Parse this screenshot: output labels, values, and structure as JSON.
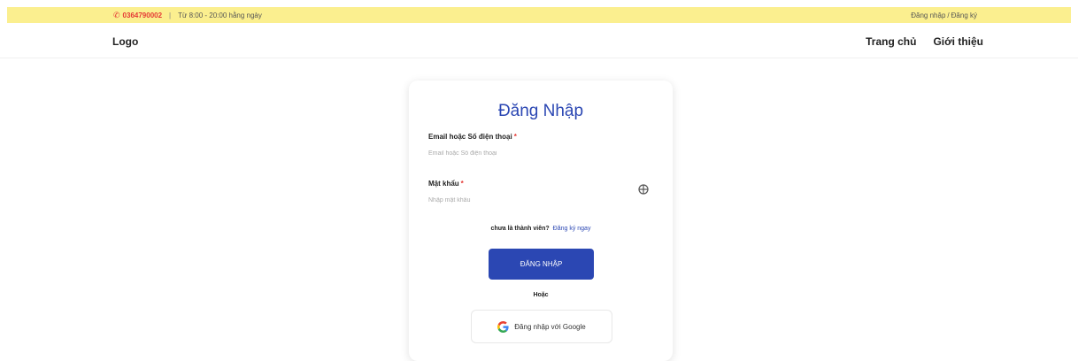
{
  "topbar": {
    "phone": "0364790002",
    "hours": "Từ 8:00 - 20:00 hằng ngày",
    "login_link": "Đăng nhập",
    "register_link": "Đăng ký",
    "separator": "/",
    "background_color": "#fbef8f"
  },
  "header": {
    "logo": "Logo",
    "nav": [
      "Trang chủ",
      "Giới thiệu"
    ]
  },
  "login_form": {
    "title": "Đăng Nhập",
    "email_label": "Email hoặc Số điện thoại",
    "email_placeholder": "Email hoặc Số điện thoại",
    "email_value": "",
    "password_label": "Mật khẩu",
    "password_placeholder": "Nhập mật khẩu",
    "password_value": "",
    "required_mark": "*",
    "register_question": "chưa là thành viên?",
    "register_link": "Đăng ký ngay",
    "submit_label": "ĐĂNG NHẬP",
    "or_text": "Hoặc",
    "google_label": "Đăng nhập với Google",
    "accent_color": "#2b47b3"
  }
}
